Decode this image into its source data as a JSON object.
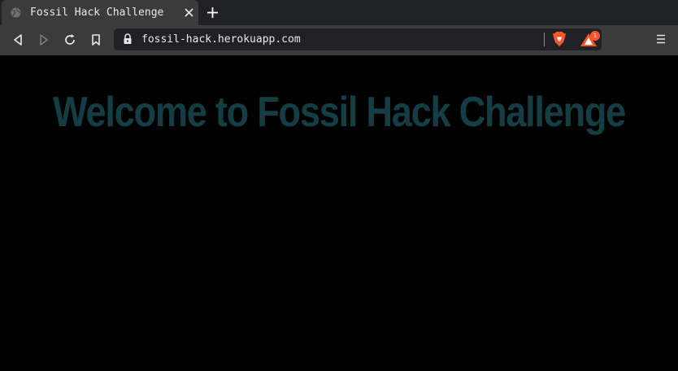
{
  "browser": {
    "tab": {
      "title": "Fossil Hack Challenge",
      "favicon": "globe-icon"
    },
    "url": "fossil-hack.herokuapp.com",
    "rewards_badge": "1",
    "colors": {
      "tabbar_bg": "#202124",
      "toolbar_bg": "#3b3b3c",
      "urlbar_bg": "#202124",
      "brave_orange": "#fb542b"
    }
  },
  "page": {
    "heading": "Welcome to Fossil Hack Challenge",
    "colors": {
      "background": "#000000",
      "heading": "#143e44"
    }
  }
}
